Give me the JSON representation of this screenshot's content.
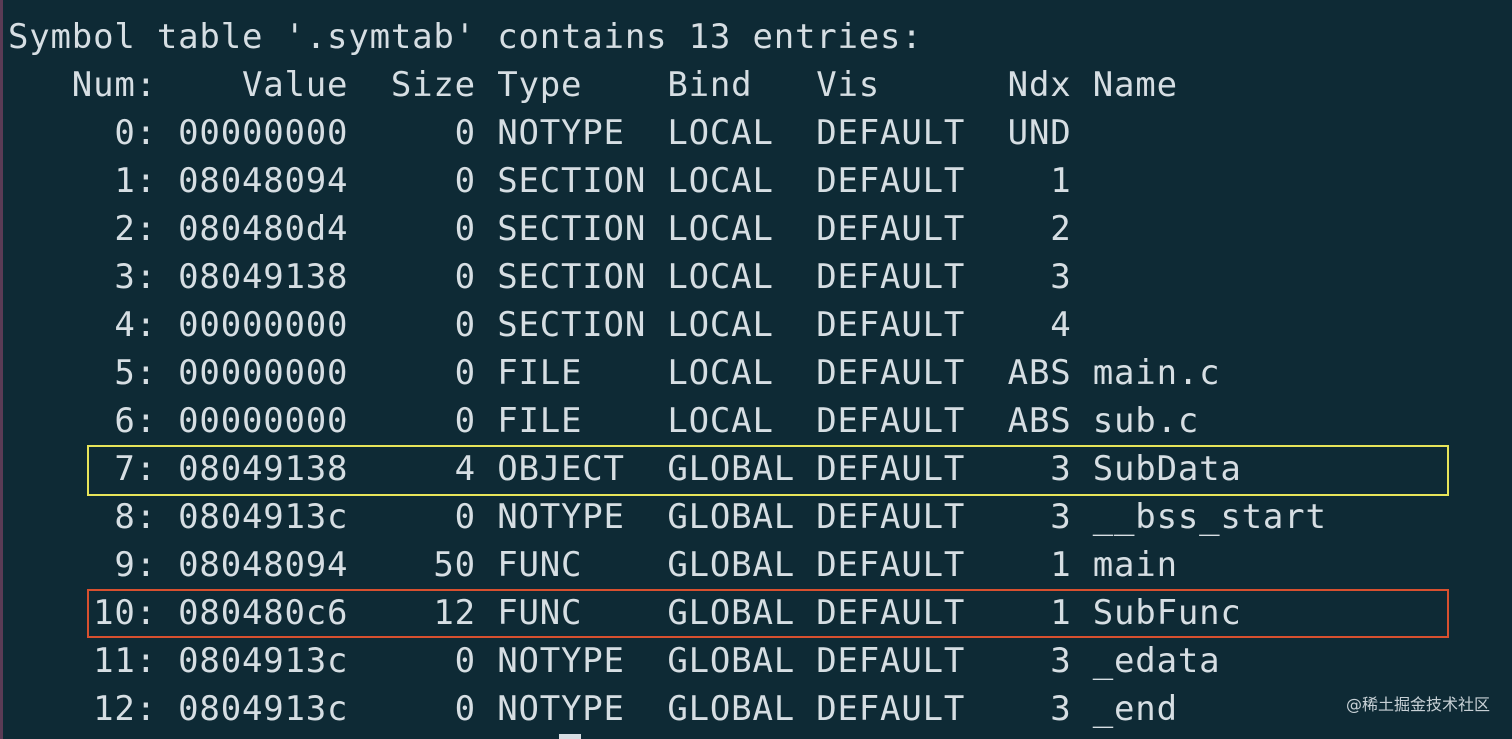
{
  "terminal": {
    "lines": [
      "Symbol table '.symtab' contains 13 entries:",
      "   Num:    Value  Size Type    Bind   Vis      Ndx Name",
      "     0: 00000000     0 NOTYPE  LOCAL  DEFAULT  UND",
      "     1: 08048094     0 SECTION LOCAL  DEFAULT    1",
      "     2: 080480d4     0 SECTION LOCAL  DEFAULT    2",
      "     3: 08049138     0 SECTION LOCAL  DEFAULT    3",
      "     4: 00000000     0 SECTION LOCAL  DEFAULT    4",
      "     5: 00000000     0 FILE    LOCAL  DEFAULT  ABS main.c",
      "     6: 00000000     0 FILE    LOCAL  DEFAULT  ABS sub.c",
      "     7: 08049138     4 OBJECT  GLOBAL DEFAULT    3 SubData",
      "     8: 0804913c     0 NOTYPE  GLOBAL DEFAULT    3 __bss_start",
      "     9: 08048094    50 FUNC    GLOBAL DEFAULT    1 main",
      "    10: 080480c6    12 FUNC    GLOBAL DEFAULT    1 SubFunc",
      "    11: 0804913c     0 NOTYPE  GLOBAL DEFAULT    3 _edata",
      "    12: 0804913c     0 NOTYPE  GLOBAL DEFAULT    3 _end"
    ]
  },
  "highlights": {
    "subdata_color": "#e7e45a",
    "subfunc_color": "#d8502f"
  },
  "colors": {
    "background": "#0e2a35",
    "text": "#d6dee3"
  },
  "watermark": "@稀土掘金技术社区"
}
